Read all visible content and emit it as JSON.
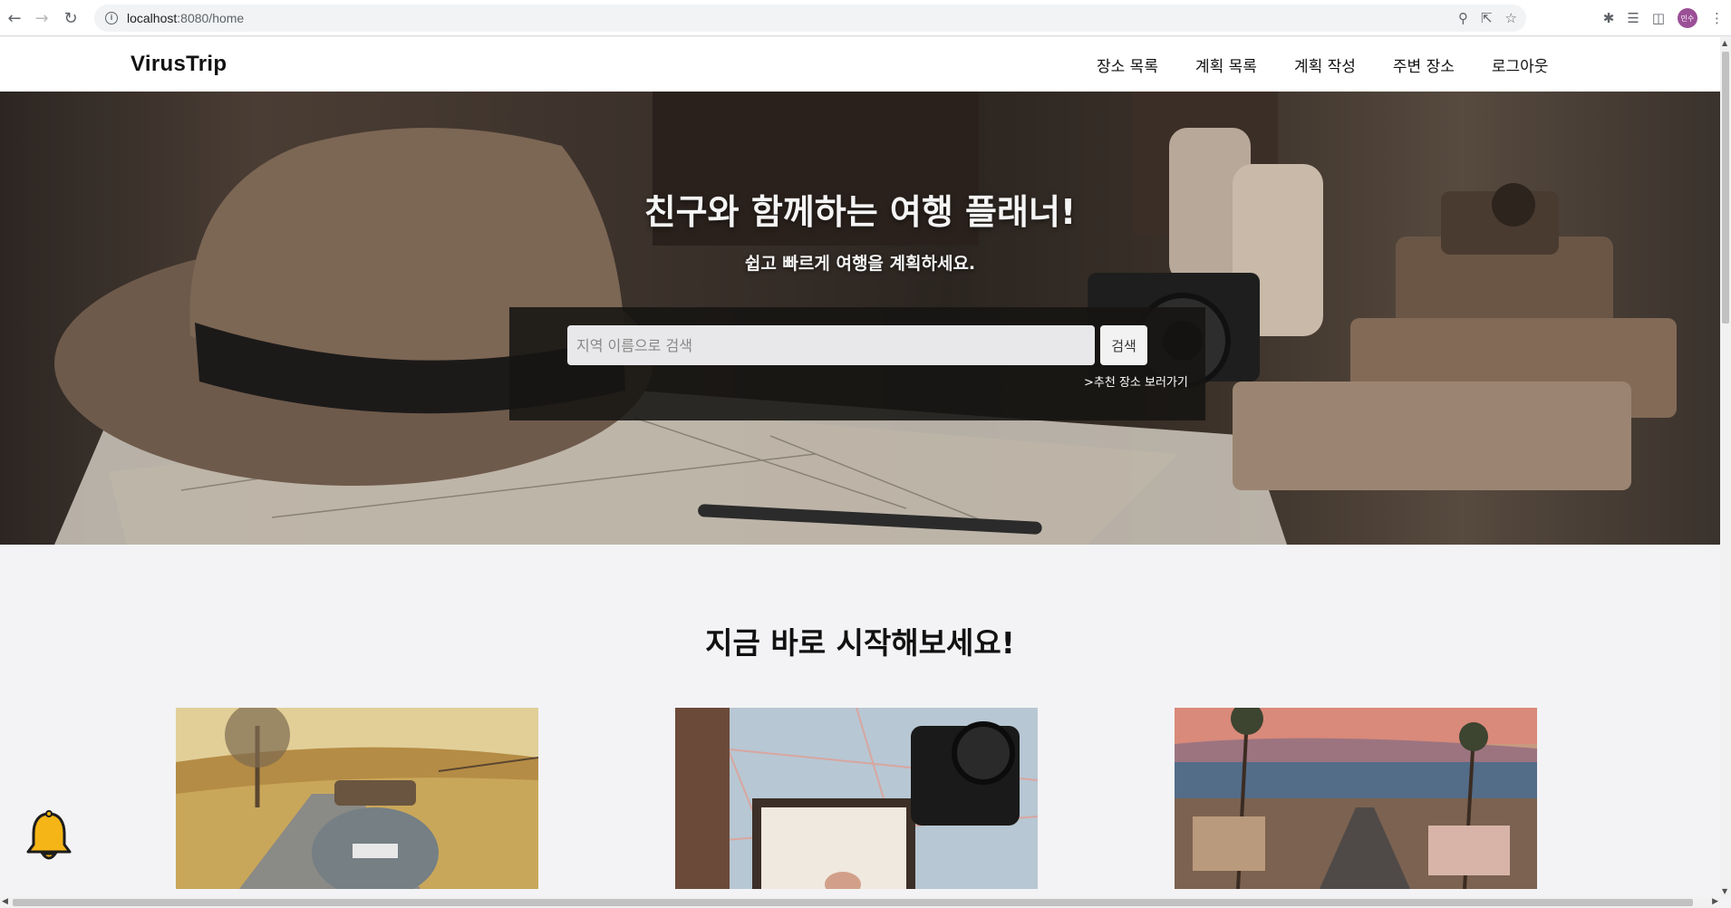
{
  "browser": {
    "url_host": "localhost",
    "url_path": ":8080/home",
    "profile_initials": "민수"
  },
  "site": {
    "brand": "VirusTrip",
    "menu": [
      {
        "label": "장소 목록"
      },
      {
        "label": "계획 목록"
      },
      {
        "label": "계획 작성"
      },
      {
        "label": "주변 장소"
      },
      {
        "label": "로그아웃"
      }
    ]
  },
  "hero": {
    "title": "친구와 함께하는 여행 플래너!",
    "subtitle": "쉽고 빠르게 여행을 계획하세요.",
    "search_placeholder": "지역 이름으로 검색",
    "search_button": "검색",
    "recommend_link": ">추천 장소 보러가기"
  },
  "section": {
    "title": "지금 바로 시작해보세요!",
    "cards": [
      {
        "image": "vintage-car-road-photo"
      },
      {
        "image": "map-camera-photo"
      },
      {
        "image": "coastal-town-palms-photo"
      }
    ]
  },
  "colors": {
    "bell": "#f5b516",
    "header_bg": "#ffffff",
    "page_bg": "#f3f3f5"
  }
}
